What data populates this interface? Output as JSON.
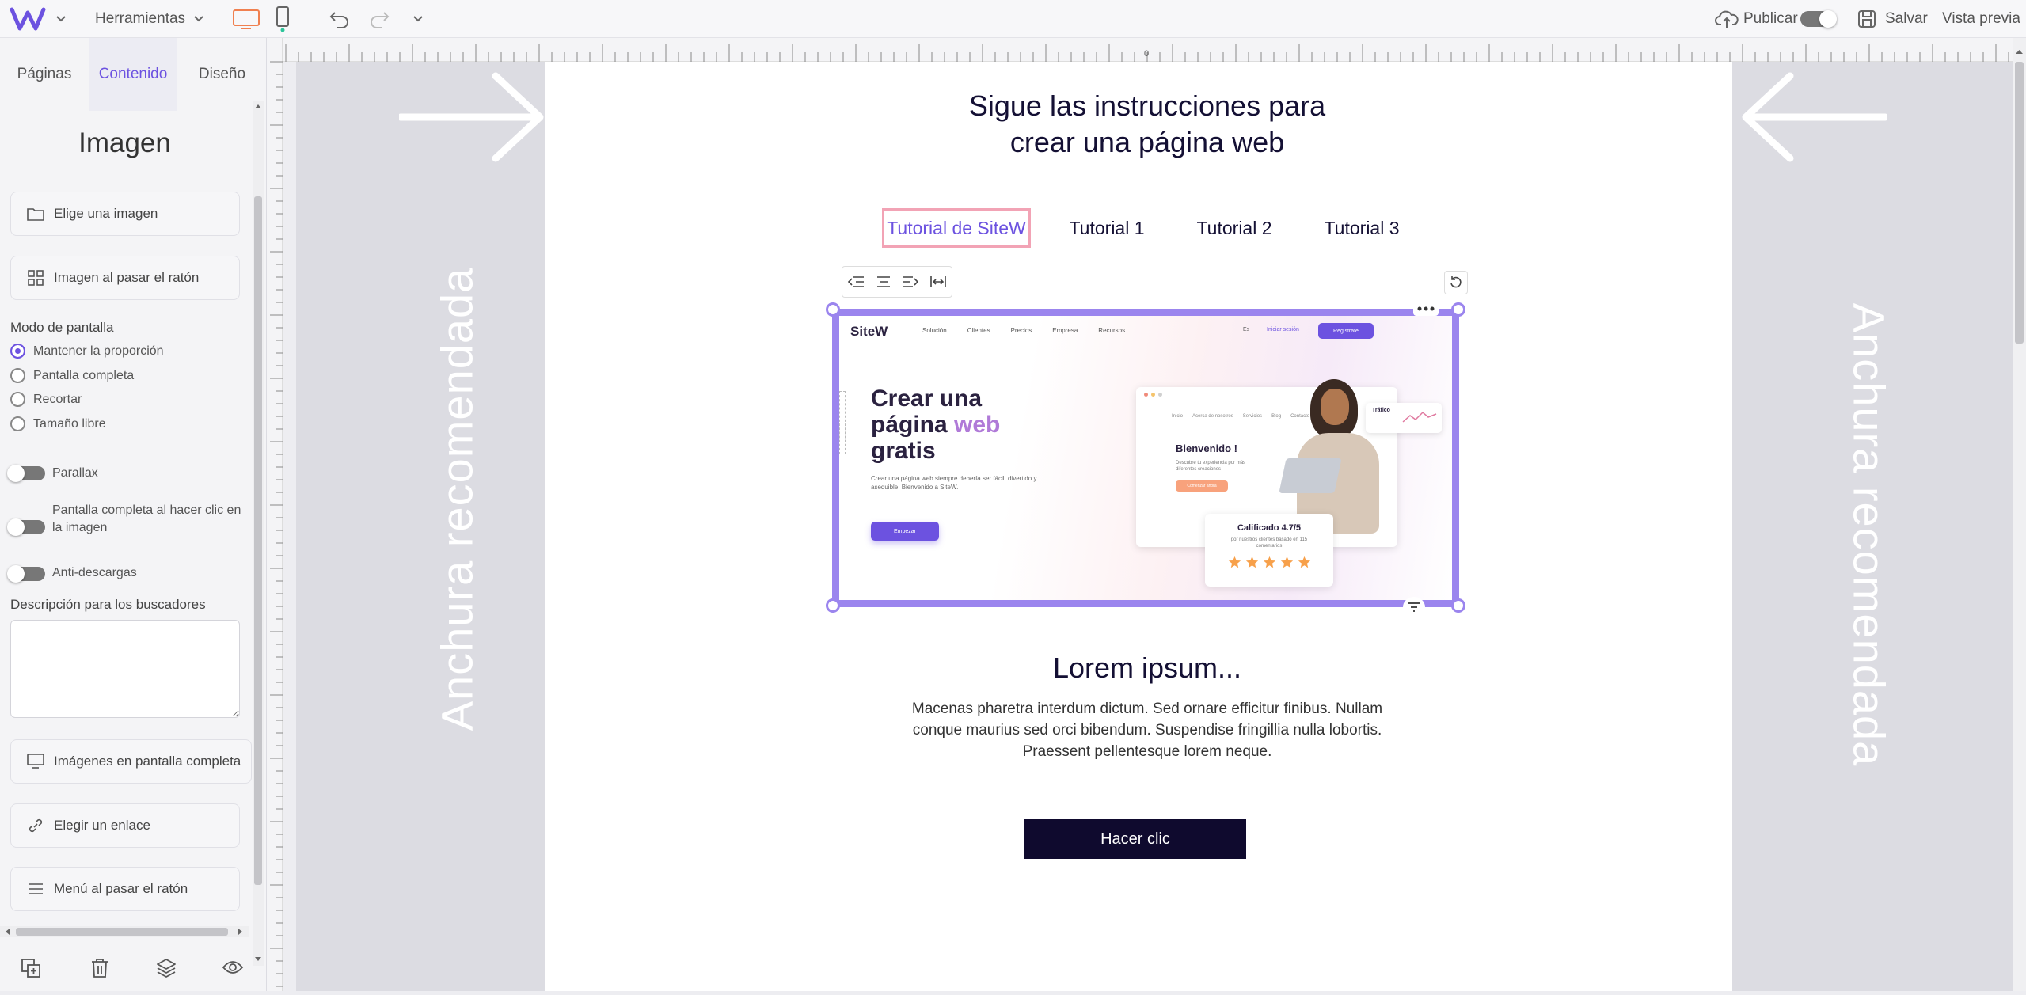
{
  "topbar": {
    "logo": "W",
    "tools_label": "Herramientas",
    "publish_label": "Publicar",
    "save_label": "Salvar",
    "preview_label": "Vista previa"
  },
  "panel": {
    "tabs": [
      "Páginas",
      "Contenido",
      "Diseño"
    ],
    "title": "Imagen",
    "choose_image": "Elige una imagen",
    "hover_image": "Imagen al pasar el ratón",
    "display_mode_label": "Modo de pantalla",
    "display_modes": [
      "Mantener la proporción",
      "Pantalla completa",
      "Recortar",
      "Tamaño libre"
    ],
    "selected_mode": "Mantener la proporción",
    "toggles": [
      "Parallax",
      "Pantalla completa al hacer clic en la imagen",
      "Anti-descargas"
    ],
    "seo_label": "Descripción para los buscadores",
    "seo_value": "",
    "fullscreen_images": "Imágenes en pantalla completa",
    "choose_link": "Elegir un enlace",
    "hover_menu": "Menú al pasar el ratón"
  },
  "canvas": {
    "ruler_zero": "0",
    "side_text": "Anchura recomendada",
    "heading_line1": "Sigue las instrucciones para",
    "heading_line2": "crear una página web",
    "tabs": [
      "Tutorial de SiteW",
      "Tutorial 1",
      "Tutorial 2",
      "Tutorial 3"
    ],
    "active_tab": 0,
    "lorem_title": "Lorem ipsum...",
    "lorem_text_1": "Macenas pharetra interdum dictum. Sed ornare efficitur finibus. Nullam",
    "lorem_text_2": "conque maurius sed orci bibendum. Suspendise fringillia nulla lobortis.",
    "lorem_text_3": "Praessent pellentesque lorem neque.",
    "cta": "Hacer clic"
  },
  "mockup": {
    "brand": "SiteW",
    "nav": [
      "Solución",
      "Clientes",
      "Precios",
      "Empresa",
      "Recursos"
    ],
    "lang": "Es",
    "login": "Iniciar sesión",
    "register": "Registrate",
    "hero_1": "Crear una",
    "hero_2a": "página ",
    "hero_2b": "web",
    "hero_3": "gratis",
    "hero_sub": "Crear una página web siempre debería ser fácil, divertido y asequible. Bienvenido a SiteW.",
    "hero_btn": "Empezar",
    "welcome": "Bienvenido !",
    "welcome_sub": "Descubre tu experiencia por más diferentes creaciones",
    "welcome_btn": "Comenzar ahora",
    "browser_nav": [
      "Inicio",
      "Acerca de nosotros",
      "Servicios",
      "Blog",
      "Contacto"
    ],
    "traffic": "Tráfico",
    "rating_title": "Calificado 4.7/5",
    "rating_sub": "por nuestros clientes basado en 115 comentarios",
    "stars": 5
  },
  "colors": {
    "accent": "#6c52e0",
    "selection": "#9b85ee",
    "cta_bg": "#0f0a2e",
    "tab_highlight": "#f2a3b5"
  }
}
